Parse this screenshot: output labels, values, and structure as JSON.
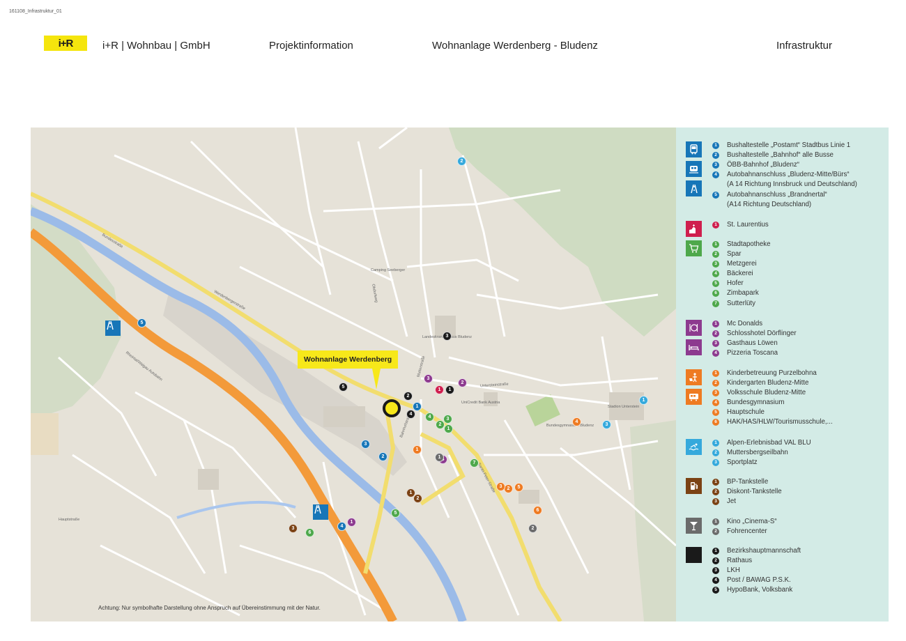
{
  "doc_ref": "161108_Infrastruktur_01",
  "header": {
    "logo": "i+R",
    "company": "i+R | Wohnbau | GmbH",
    "section": "Projektinformation",
    "project": "Wohnanlage Werdenberg - Bludenz",
    "topic": "Infrastruktur"
  },
  "map": {
    "callout": "Wohnanlage Werdenberg",
    "disclaimer": "Achtung: Nur symbolhafte Darstellung ohne Anspruch auf Übereinstimmung mit der Natur.",
    "labels": {
      "bundesstrasse": "Bundesstraße",
      "werdenbergerstrasse": "Werdenbergerstraße",
      "rhein_walgau": "Rheintal/Walgau Autobahn",
      "hauptstrasse": "Hauptstraße",
      "obdorfweg": "Obdorfweg",
      "bahnhofstrasse": "Bahnhofstraße",
      "mutterstrasse": "Mutterstraße",
      "sankt_peter": "Sankt-Peter-Straße",
      "untersteinstrasse": "Untersteinstraße",
      "bundesgymnasium": "Bundesgymnasium Bludenz",
      "stadion": "Stadion Unterstein",
      "landeskrankenhaus": "Landeskrankenhaus Bludenz",
      "camping": "Camping Seeberger",
      "unicredit": "UniCredit Bank Austria"
    }
  },
  "colors": {
    "transport": "#1776b8",
    "church": "#cf1f4e",
    "shopping": "#4ea84b",
    "food": "#8d3a8f",
    "education": "#ee7b22",
    "sport": "#35a9dc",
    "fuel": "#7b4214",
    "leisure": "#6b6b6b",
    "public": "#1a1a1a"
  },
  "legend": [
    {
      "key": "transport",
      "icons": [
        "bus-icon",
        "train-icon",
        "motorway-icon"
      ],
      "items": [
        {
          "n": "1",
          "text": "Bushaltestelle „Postamt“ Stadtbus Linie 1"
        },
        {
          "n": "2",
          "text": "Bushaltestelle „Bahnhof“ alle Busse"
        },
        {
          "n": "3",
          "text": "ÖBB-Bahnhof „Bludenz“"
        },
        {
          "n": "4",
          "text": "Autobahnanschluss „Bludenz-Mitte/Bürs“",
          "text2": "(A 14 Richtung Innsbruck und Deutschland)"
        },
        {
          "n": "5",
          "text": "Autobahnanschluss „Brandnertal“",
          "text2": "(A14 Richtung Deutschland)"
        }
      ]
    },
    {
      "key": "church",
      "icons": [
        "church-icon"
      ],
      "items": [
        {
          "n": "1",
          "text": "St. Laurentius"
        }
      ]
    },
    {
      "key": "shopping",
      "icons": [
        "shopping-cart-icon"
      ],
      "items": [
        {
          "n": "1",
          "text": "Stadtapotheke"
        },
        {
          "n": "2",
          "text": "Spar"
        },
        {
          "n": "3",
          "text": "Metzgerei"
        },
        {
          "n": "4",
          "text": "Bäckerei"
        },
        {
          "n": "5",
          "text": "Hofer"
        },
        {
          "n": "6",
          "text": "Zimbapark"
        },
        {
          "n": "7",
          "text": "Sutterlüty"
        }
      ]
    },
    {
      "key": "food",
      "icons": [
        "restaurant-icon",
        "hotel-bed-icon"
      ],
      "items": [
        {
          "n": "1",
          "text": "Mc Donalds"
        },
        {
          "n": "2",
          "text": "Schlosshotel Dörflinger"
        },
        {
          "n": "3",
          "text": "Gasthaus Löwen"
        },
        {
          "n": "4",
          "text": "Pizzeria Toscana"
        }
      ]
    },
    {
      "key": "education",
      "icons": [
        "children-icon",
        "school-bus-icon"
      ],
      "items": [
        {
          "n": "1",
          "text": "Kinderbetreuung Purzelbohna"
        },
        {
          "n": "2",
          "text": "Kindergarten Bludenz-Mitte"
        },
        {
          "n": "3",
          "text": "Volksschule Bludenz-Mitte"
        },
        {
          "n": "4",
          "text": "Bundesgymnasium"
        },
        {
          "n": "5",
          "text": "Hauptschule"
        },
        {
          "n": "6",
          "text": "HAK/HAS/HLW/Tourismusschule,..."
        }
      ]
    },
    {
      "key": "sport",
      "icons": [
        "swimming-icon"
      ],
      "items": [
        {
          "n": "1",
          "text": "Alpen-Erlebnisbad VAL BLU"
        },
        {
          "n": "2",
          "text": "Muttersbergseilbahn"
        },
        {
          "n": "3",
          "text": "Sportplatz"
        }
      ]
    },
    {
      "key": "fuel",
      "icons": [
        "fuel-pump-icon"
      ],
      "items": [
        {
          "n": "1",
          "text": "BP-Tankstelle"
        },
        {
          "n": "2",
          "text": "Diskont-Tankstelle"
        },
        {
          "n": "3",
          "text": "Jet"
        }
      ]
    },
    {
      "key": "leisure",
      "icons": [
        "cocktail-icon"
      ],
      "items": [
        {
          "n": "1",
          "text": "Kino „Cinema-S“"
        },
        {
          "n": "2",
          "text": "Fohrencenter"
        }
      ]
    },
    {
      "key": "public",
      "icons": [
        "public-building-icon"
      ],
      "items": [
        {
          "n": "1",
          "text": "Bezirkshauptmannschaft"
        },
        {
          "n": "2",
          "text": "Rathaus"
        },
        {
          "n": "3",
          "text": "LKH"
        },
        {
          "n": "4",
          "text": "Post / BAWAG P.S.K."
        },
        {
          "n": "5",
          "text": "HypoBank, Volksbank"
        }
      ]
    }
  ],
  "markers": [
    {
      "cat": "transport",
      "n": "1"
    },
    {
      "cat": "transport",
      "n": "2"
    },
    {
      "cat": "transport",
      "n": "3"
    },
    {
      "cat": "transport",
      "n": "4"
    },
    {
      "cat": "transport",
      "n": "5"
    },
    {
      "cat": "church",
      "n": "1"
    },
    {
      "cat": "shopping",
      "n": "1"
    },
    {
      "cat": "shopping",
      "n": "2"
    },
    {
      "cat": "shopping",
      "n": "3"
    },
    {
      "cat": "shopping",
      "n": "4"
    },
    {
      "cat": "shopping",
      "n": "5"
    },
    {
      "cat": "shopping",
      "n": "6"
    },
    {
      "cat": "shopping",
      "n": "7"
    },
    {
      "cat": "food",
      "n": "1"
    },
    {
      "cat": "food",
      "n": "2"
    },
    {
      "cat": "food",
      "n": "3"
    },
    {
      "cat": "food",
      "n": "4"
    },
    {
      "cat": "education",
      "n": "1"
    },
    {
      "cat": "education",
      "n": "2"
    },
    {
      "cat": "education",
      "n": "3"
    },
    {
      "cat": "education",
      "n": "4"
    },
    {
      "cat": "education",
      "n": "5"
    },
    {
      "cat": "education",
      "n": "6"
    },
    {
      "cat": "sport",
      "n": "1"
    },
    {
      "cat": "sport",
      "n": "2"
    },
    {
      "cat": "sport",
      "n": "3"
    },
    {
      "cat": "fuel",
      "n": "1"
    },
    {
      "cat": "fuel",
      "n": "2"
    },
    {
      "cat": "fuel",
      "n": "3"
    },
    {
      "cat": "leisure",
      "n": "1"
    },
    {
      "cat": "leisure",
      "n": "2"
    },
    {
      "cat": "public",
      "n": "1"
    },
    {
      "cat": "public",
      "n": "2"
    },
    {
      "cat": "public",
      "n": "3"
    },
    {
      "cat": "public",
      "n": "4"
    },
    {
      "cat": "public",
      "n": "5"
    }
  ]
}
